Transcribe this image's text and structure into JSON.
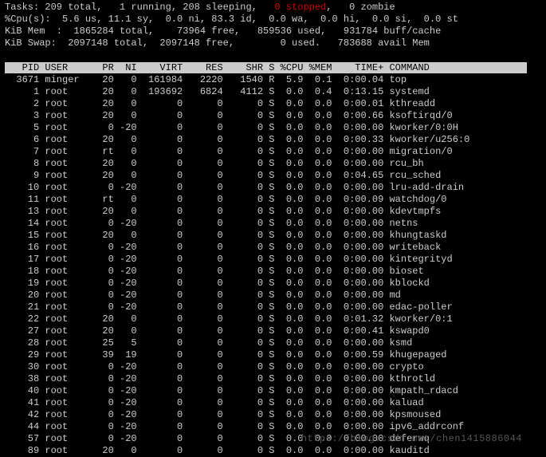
{
  "summary": {
    "tasks": {
      "total": 209,
      "running": 1,
      "sleeping": 208,
      "stopped": 0,
      "zombie": 0
    },
    "cpu": {
      "us": "5.6",
      "sy": "11.1",
      "ni": "0.0",
      "id": "83.3",
      "wa": "0.0",
      "hi": "0.0",
      "si": "0.0",
      "st": "0.0"
    },
    "mem": {
      "unit": "KiB Mem ",
      "total": 1865284,
      "free": 73964,
      "used": 859536,
      "buff": 931784,
      "buff_label": "buff/cache"
    },
    "swap": {
      "unit": "KiB Swap",
      "total": 2097148,
      "free": 2097148,
      "used": 0,
      "avail": 783688,
      "avail_label": "avail Mem"
    }
  },
  "columns": [
    "PID",
    "USER",
    "PR",
    "NI",
    "VIRT",
    "RES",
    "SHR",
    "S",
    "%CPU",
    "%MEM",
    "TIME+",
    "COMMAND"
  ],
  "rows": [
    {
      "PID": 3671,
      "USER": "minger",
      "PR": "20",
      "NI": 0,
      "VIRT": 161984,
      "RES": 2220,
      "SHR": 1540,
      "S": "R",
      "CPU": "5.9",
      "MEM": "0.1",
      "TIME": "0:00.04",
      "CMD": "top"
    },
    {
      "PID": 1,
      "USER": "root",
      "PR": "20",
      "NI": 0,
      "VIRT": 193692,
      "RES": 6824,
      "SHR": 4112,
      "S": "S",
      "CPU": "0.0",
      "MEM": "0.4",
      "TIME": "0:13.15",
      "CMD": "systemd"
    },
    {
      "PID": 2,
      "USER": "root",
      "PR": "20",
      "NI": 0,
      "VIRT": 0,
      "RES": 0,
      "SHR": 0,
      "S": "S",
      "CPU": "0.0",
      "MEM": "0.0",
      "TIME": "0:00.01",
      "CMD": "kthreadd"
    },
    {
      "PID": 3,
      "USER": "root",
      "PR": "20",
      "NI": 0,
      "VIRT": 0,
      "RES": 0,
      "SHR": 0,
      "S": "S",
      "CPU": "0.0",
      "MEM": "0.0",
      "TIME": "0:00.66",
      "CMD": "ksoftirqd/0"
    },
    {
      "PID": 5,
      "USER": "root",
      "PR": "0",
      "NI": -20,
      "VIRT": 0,
      "RES": 0,
      "SHR": 0,
      "S": "S",
      "CPU": "0.0",
      "MEM": "0.0",
      "TIME": "0:00.00",
      "CMD": "kworker/0:0H"
    },
    {
      "PID": 6,
      "USER": "root",
      "PR": "20",
      "NI": 0,
      "VIRT": 0,
      "RES": 0,
      "SHR": 0,
      "S": "S",
      "CPU": "0.0",
      "MEM": "0.0",
      "TIME": "0:00.33",
      "CMD": "kworker/u256:0"
    },
    {
      "PID": 7,
      "USER": "root",
      "PR": "rt",
      "NI": 0,
      "VIRT": 0,
      "RES": 0,
      "SHR": 0,
      "S": "S",
      "CPU": "0.0",
      "MEM": "0.0",
      "TIME": "0:00.00",
      "CMD": "migration/0"
    },
    {
      "PID": 8,
      "USER": "root",
      "PR": "20",
      "NI": 0,
      "VIRT": 0,
      "RES": 0,
      "SHR": 0,
      "S": "S",
      "CPU": "0.0",
      "MEM": "0.0",
      "TIME": "0:00.00",
      "CMD": "rcu_bh"
    },
    {
      "PID": 9,
      "USER": "root",
      "PR": "20",
      "NI": 0,
      "VIRT": 0,
      "RES": 0,
      "SHR": 0,
      "S": "S",
      "CPU": "0.0",
      "MEM": "0.0",
      "TIME": "0:04.65",
      "CMD": "rcu_sched"
    },
    {
      "PID": 10,
      "USER": "root",
      "PR": "0",
      "NI": -20,
      "VIRT": 0,
      "RES": 0,
      "SHR": 0,
      "S": "S",
      "CPU": "0.0",
      "MEM": "0.0",
      "TIME": "0:00.00",
      "CMD": "lru-add-drain"
    },
    {
      "PID": 11,
      "USER": "root",
      "PR": "rt",
      "NI": 0,
      "VIRT": 0,
      "RES": 0,
      "SHR": 0,
      "S": "S",
      "CPU": "0.0",
      "MEM": "0.0",
      "TIME": "0:00.09",
      "CMD": "watchdog/0"
    },
    {
      "PID": 13,
      "USER": "root",
      "PR": "20",
      "NI": 0,
      "VIRT": 0,
      "RES": 0,
      "SHR": 0,
      "S": "S",
      "CPU": "0.0",
      "MEM": "0.0",
      "TIME": "0:00.00",
      "CMD": "kdevtmpfs"
    },
    {
      "PID": 14,
      "USER": "root",
      "PR": "0",
      "NI": -20,
      "VIRT": 0,
      "RES": 0,
      "SHR": 0,
      "S": "S",
      "CPU": "0.0",
      "MEM": "0.0",
      "TIME": "0:00.00",
      "CMD": "netns"
    },
    {
      "PID": 15,
      "USER": "root",
      "PR": "20",
      "NI": 0,
      "VIRT": 0,
      "RES": 0,
      "SHR": 0,
      "S": "S",
      "CPU": "0.0",
      "MEM": "0.0",
      "TIME": "0:00.00",
      "CMD": "khungtaskd"
    },
    {
      "PID": 16,
      "USER": "root",
      "PR": "0",
      "NI": -20,
      "VIRT": 0,
      "RES": 0,
      "SHR": 0,
      "S": "S",
      "CPU": "0.0",
      "MEM": "0.0",
      "TIME": "0:00.00",
      "CMD": "writeback"
    },
    {
      "PID": 17,
      "USER": "root",
      "PR": "0",
      "NI": -20,
      "VIRT": 0,
      "RES": 0,
      "SHR": 0,
      "S": "S",
      "CPU": "0.0",
      "MEM": "0.0",
      "TIME": "0:00.00",
      "CMD": "kintegrityd"
    },
    {
      "PID": 18,
      "USER": "root",
      "PR": "0",
      "NI": -20,
      "VIRT": 0,
      "RES": 0,
      "SHR": 0,
      "S": "S",
      "CPU": "0.0",
      "MEM": "0.0",
      "TIME": "0:00.00",
      "CMD": "bioset"
    },
    {
      "PID": 19,
      "USER": "root",
      "PR": "0",
      "NI": -20,
      "VIRT": 0,
      "RES": 0,
      "SHR": 0,
      "S": "S",
      "CPU": "0.0",
      "MEM": "0.0",
      "TIME": "0:00.00",
      "CMD": "kblockd"
    },
    {
      "PID": 20,
      "USER": "root",
      "PR": "0",
      "NI": -20,
      "VIRT": 0,
      "RES": 0,
      "SHR": 0,
      "S": "S",
      "CPU": "0.0",
      "MEM": "0.0",
      "TIME": "0:00.00",
      "CMD": "md"
    },
    {
      "PID": 21,
      "USER": "root",
      "PR": "0",
      "NI": -20,
      "VIRT": 0,
      "RES": 0,
      "SHR": 0,
      "S": "S",
      "CPU": "0.0",
      "MEM": "0.0",
      "TIME": "0:00.00",
      "CMD": "edac-poller"
    },
    {
      "PID": 22,
      "USER": "root",
      "PR": "20",
      "NI": 0,
      "VIRT": 0,
      "RES": 0,
      "SHR": 0,
      "S": "S",
      "CPU": "0.0",
      "MEM": "0.0",
      "TIME": "0:01.32",
      "CMD": "kworker/0:1"
    },
    {
      "PID": 27,
      "USER": "root",
      "PR": "20",
      "NI": 0,
      "VIRT": 0,
      "RES": 0,
      "SHR": 0,
      "S": "S",
      "CPU": "0.0",
      "MEM": "0.0",
      "TIME": "0:00.41",
      "CMD": "kswapd0"
    },
    {
      "PID": 28,
      "USER": "root",
      "PR": "25",
      "NI": 5,
      "VIRT": 0,
      "RES": 0,
      "SHR": 0,
      "S": "S",
      "CPU": "0.0",
      "MEM": "0.0",
      "TIME": "0:00.00",
      "CMD": "ksmd"
    },
    {
      "PID": 29,
      "USER": "root",
      "PR": "39",
      "NI": 19,
      "VIRT": 0,
      "RES": 0,
      "SHR": 0,
      "S": "S",
      "CPU": "0.0",
      "MEM": "0.0",
      "TIME": "0:00.59",
      "CMD": "khugepaged"
    },
    {
      "PID": 30,
      "USER": "root",
      "PR": "0",
      "NI": -20,
      "VIRT": 0,
      "RES": 0,
      "SHR": 0,
      "S": "S",
      "CPU": "0.0",
      "MEM": "0.0",
      "TIME": "0:00.00",
      "CMD": "crypto"
    },
    {
      "PID": 38,
      "USER": "root",
      "PR": "0",
      "NI": -20,
      "VIRT": 0,
      "RES": 0,
      "SHR": 0,
      "S": "S",
      "CPU": "0.0",
      "MEM": "0.0",
      "TIME": "0:00.00",
      "CMD": "kthrotld"
    },
    {
      "PID": 40,
      "USER": "root",
      "PR": "0",
      "NI": -20,
      "VIRT": 0,
      "RES": 0,
      "SHR": 0,
      "S": "S",
      "CPU": "0.0",
      "MEM": "0.0",
      "TIME": "0:00.00",
      "CMD": "kmpath_rdacd"
    },
    {
      "PID": 41,
      "USER": "root",
      "PR": "0",
      "NI": -20,
      "VIRT": 0,
      "RES": 0,
      "SHR": 0,
      "S": "S",
      "CPU": "0.0",
      "MEM": "0.0",
      "TIME": "0:00.00",
      "CMD": "kaluad"
    },
    {
      "PID": 42,
      "USER": "root",
      "PR": "0",
      "NI": -20,
      "VIRT": 0,
      "RES": 0,
      "SHR": 0,
      "S": "S",
      "CPU": "0.0",
      "MEM": "0.0",
      "TIME": "0:00.00",
      "CMD": "kpsmoused"
    },
    {
      "PID": 44,
      "USER": "root",
      "PR": "0",
      "NI": -20,
      "VIRT": 0,
      "RES": 0,
      "SHR": 0,
      "S": "S",
      "CPU": "0.0",
      "MEM": "0.0",
      "TIME": "0:00.00",
      "CMD": "ipv6_addrconf"
    },
    {
      "PID": 57,
      "USER": "root",
      "PR": "0",
      "NI": -20,
      "VIRT": 0,
      "RES": 0,
      "SHR": 0,
      "S": "S",
      "CPU": "0.0",
      "MEM": "0.0",
      "TIME": "0:00.00",
      "CMD": "deferwq"
    },
    {
      "PID": 89,
      "USER": "root",
      "PR": "20",
      "NI": 0,
      "VIRT": 0,
      "RES": 0,
      "SHR": 0,
      "S": "S",
      "CPU": "0.0",
      "MEM": "0.0",
      "TIME": "0:00.00",
      "CMD": "kauditd"
    }
  ],
  "watermark": "https://blog.csdn.net/chen1415886044"
}
